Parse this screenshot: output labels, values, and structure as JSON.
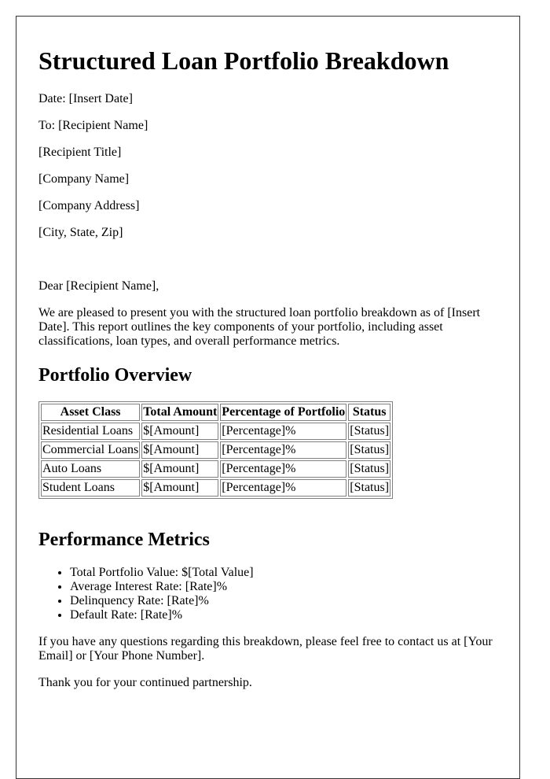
{
  "document": {
    "title": "Structured Loan Portfolio Breakdown",
    "header_lines": [
      "Date: [Insert Date]",
      "To: [Recipient Name]",
      "[Recipient Title]",
      "[Company Name]",
      "[Company Address]",
      "[City, State, Zip]"
    ],
    "salutation": "Dear [Recipient Name],",
    "intro": "We are pleased to present you with the structured loan portfolio breakdown as of [Insert Date]. This report outlines the key components of your portfolio, including asset classifications, loan types, and overall performance metrics.",
    "overview_heading": "Portfolio Overview",
    "table": {
      "headers": [
        "Asset Class",
        "Total Amount",
        "Percentage of Portfolio",
        "Status"
      ],
      "rows": [
        [
          "Residential Loans",
          "$[Amount]",
          "[Percentage]%",
          "[Status]"
        ],
        [
          "Commercial Loans",
          "$[Amount]",
          "[Percentage]%",
          "[Status]"
        ],
        [
          "Auto Loans",
          "$[Amount]",
          "[Percentage]%",
          "[Status]"
        ],
        [
          "Student Loans",
          "$[Amount]",
          "[Percentage]%",
          "[Status]"
        ]
      ]
    },
    "metrics_heading": "Performance Metrics",
    "metrics": [
      "Total Portfolio Value: $[Total Value]",
      "Average Interest Rate: [Rate]%",
      "Delinquency Rate: [Rate]%",
      "Default Rate: [Rate]%"
    ],
    "contact": "If you have any questions regarding this breakdown, please feel free to contact us at [Your Email] or [Your Phone Number].",
    "closing": "Thank you for your continued partnership."
  }
}
